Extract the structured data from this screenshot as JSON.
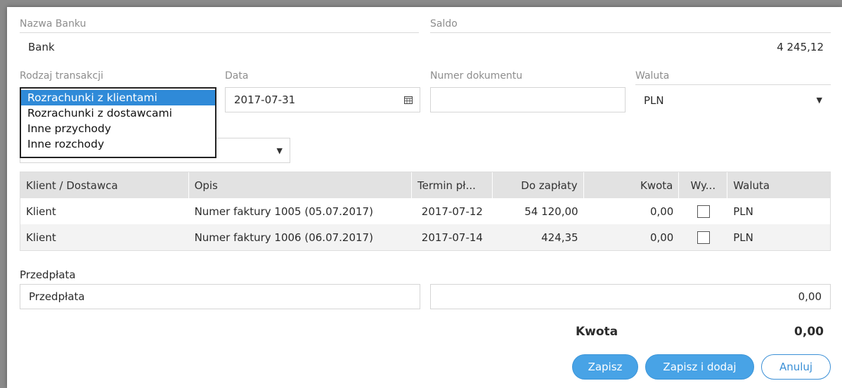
{
  "bank": {
    "label": "Nazwa Banku",
    "value": "Bank"
  },
  "saldo": {
    "label": "Saldo",
    "value": "4 245,12"
  },
  "transaction_type": {
    "label": "Rodzaj transakcji",
    "options": [
      "Rozrachunki z klientami",
      "Rozrachunki z dostawcami",
      "Inne przychody",
      "Inne rozchody"
    ],
    "selected_index": 0
  },
  "date": {
    "label": "Data",
    "value": "2017-07-31"
  },
  "doc_number": {
    "label": "Numer dokumentu",
    "value": ""
  },
  "currency": {
    "label": "Waluta",
    "value": "PLN"
  },
  "table": {
    "headers": [
      "Klient / Dostawca",
      "Opis",
      "Termin pł...",
      "Do zapłaty",
      "Kwota",
      "Wy...",
      "Waluta"
    ],
    "rows": [
      {
        "party": "Klient",
        "desc": "Numer faktury 1005 (05.07.2017)",
        "due": "2017-07-12",
        "to_pay": "54 120,00",
        "amount": "0,00",
        "checked": false,
        "currency": "PLN"
      },
      {
        "party": "Klient",
        "desc": "Numer faktury 1006 (06.07.2017)",
        "due": "2017-07-14",
        "to_pay": "424,35",
        "amount": "0,00",
        "checked": false,
        "currency": "PLN"
      }
    ]
  },
  "prepayment": {
    "label": "Przedpłata",
    "name_value": "Przedpłata",
    "amount_value": "0,00"
  },
  "total": {
    "label": "Kwota",
    "value": "0,00"
  },
  "buttons": {
    "save": "Zapisz",
    "save_add": "Zapisz i dodaj",
    "cancel": "Anuluj"
  },
  "colors": {
    "accent": "#48a3e6",
    "selection": "#2f8ad8"
  },
  "icons": {
    "calendar": "calendar-icon",
    "dropdown": "chevron-down-icon",
    "checkbox": "checkbox-icon"
  }
}
